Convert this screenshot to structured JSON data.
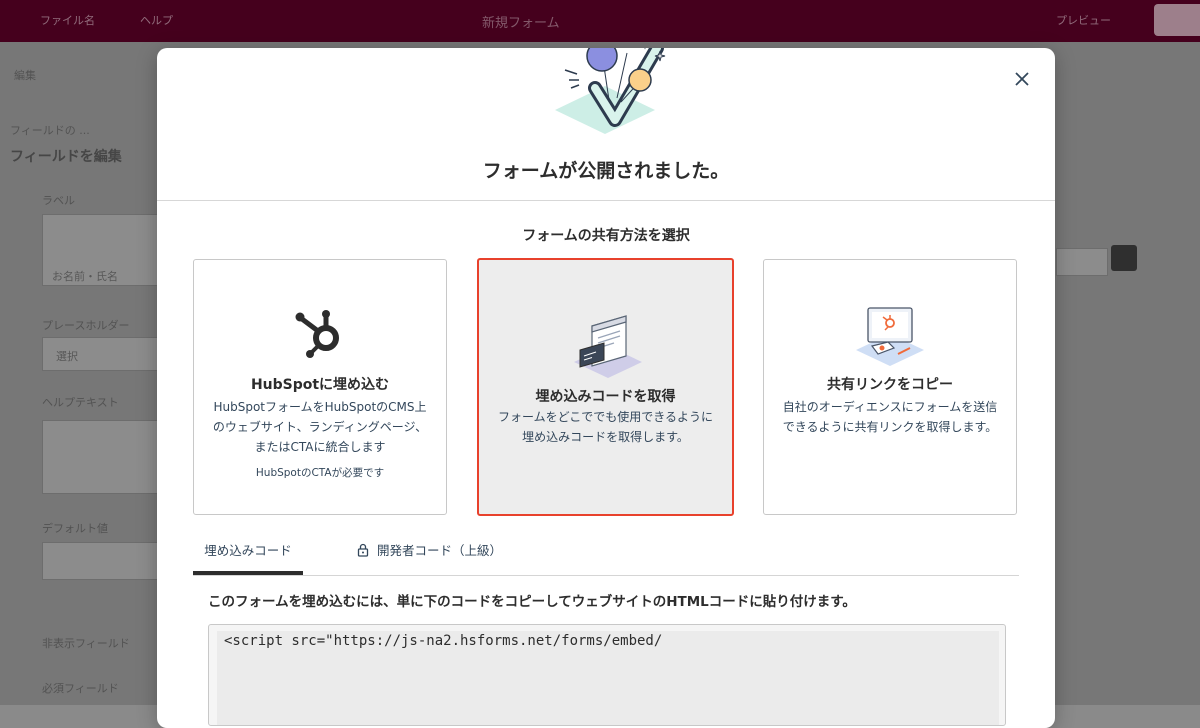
{
  "app": {
    "topbar": {
      "nav1": "ファイル名",
      "nav2": "ヘルプ",
      "title": "新規フォーム",
      "right": "プレビュー"
    },
    "left_panel": {
      "header": "編集",
      "breadcrumb": "フィールドの ...",
      "section_title": "フィールドを編集",
      "labels": [
        "ラベル",
        "プレースホルダー",
        "ヘルプテキスト",
        "デフォルト値"
      ],
      "values": [
        "お名前・氏名",
        "選択"
      ],
      "footer": [
        "非表示フィールド",
        "必須フィールド"
      ]
    }
  },
  "modal": {
    "title": "フォームが公開されました。",
    "subtitle": "フォームの共有方法を選択",
    "close_label": "×",
    "cards": [
      {
        "title": "HubSpotに埋め込む",
        "description": "HubSpotフォームをHubSpotのCMS上のウェブサイト、ランディングページ、またはCTAに統合します",
        "note": "HubSpotのCTAが必要です",
        "icon": "hubspot-sprocket-icon",
        "selected": false
      },
      {
        "title": "埋め込みコードを取得",
        "description": "フォームをどこででも使用できるように埋め込みコードを取得します。",
        "icon": "embed-code-window-icon",
        "selected": true
      },
      {
        "title": "共有リンクをコピー",
        "description": "自社のオーディエンスにフォームを送信できるように共有リンクを取得します。",
        "icon": "share-link-monitor-icon",
        "selected": false
      }
    ],
    "tabs": [
      {
        "label": "埋め込みコード",
        "active": true
      },
      {
        "label": "開発者コード（上級）",
        "icon": "lock-icon",
        "active": false
      }
    ],
    "instruction": "このフォームを埋め込むには、単に下のコードをコピーしてウェブサイトのHTMLコードに貼り付けます。",
    "code": "<script src=\"https://js-na2.hsforms.net/forms/embed/"
  },
  "colors": {
    "topbar": "#45001d",
    "selected_border": "#e8412c",
    "selected_bg": "#ededed",
    "text": "#2d2d2d"
  }
}
